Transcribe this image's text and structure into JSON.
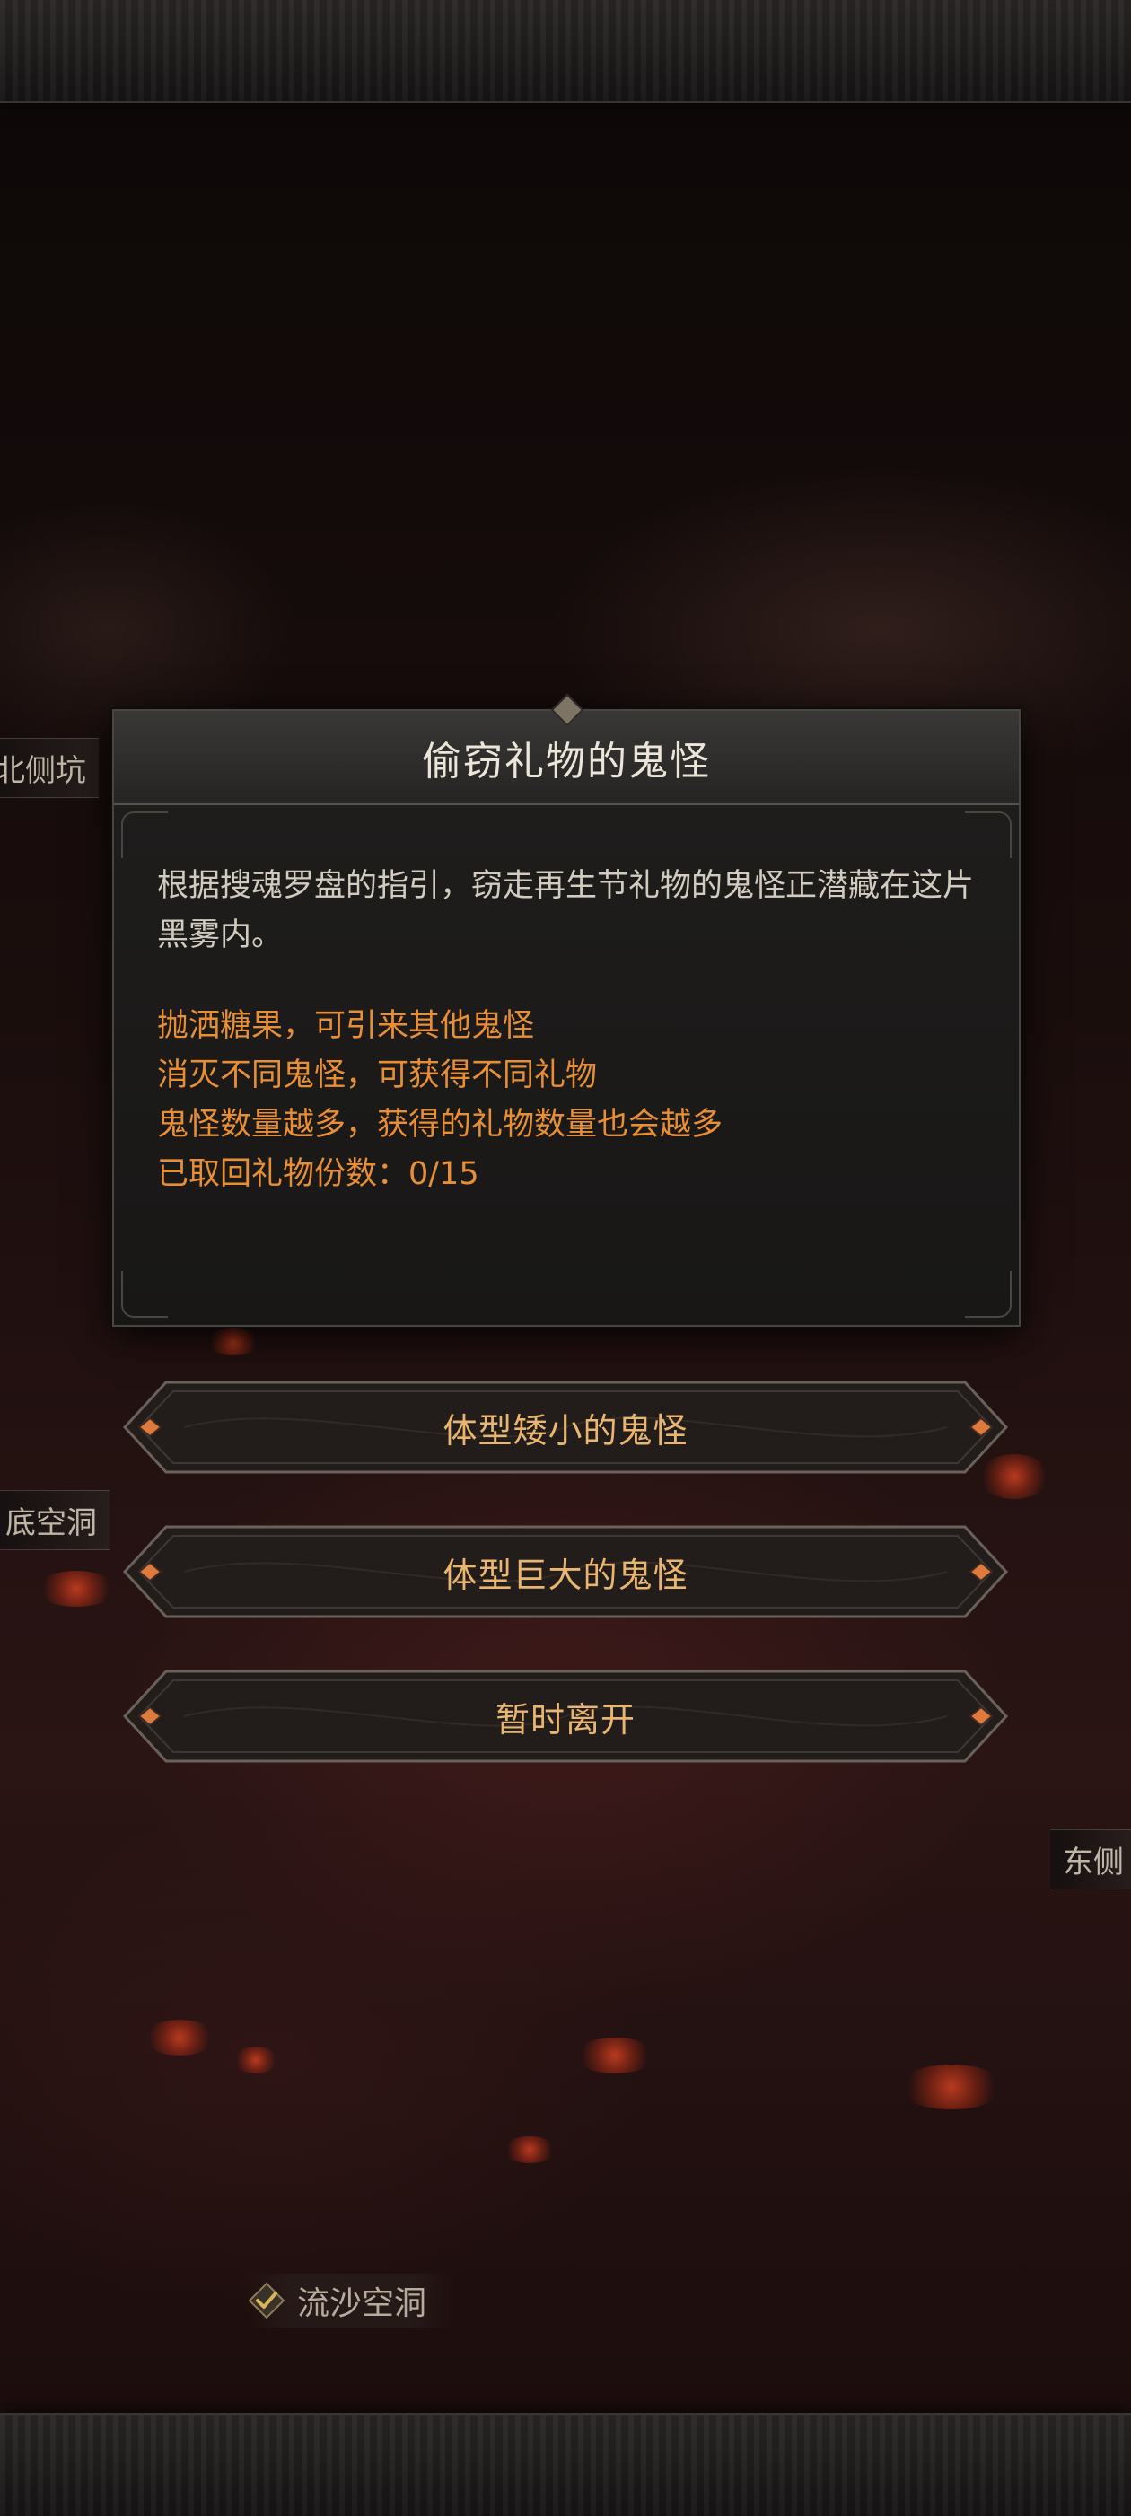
{
  "map_labels": {
    "north": "北侧坑",
    "bottom_cave": "底空洞",
    "east": "东侧",
    "quicksand": "流沙空洞"
  },
  "dialog": {
    "title": "偷窃礼物的鬼怪",
    "description": "根据搜魂罗盘的指引，窃走再生节礼物的鬼怪正潜藏在这片黑雾内。",
    "hints": [
      "抛洒糖果，可引来其他鬼怪",
      "消灭不同鬼怪，可获得不同礼物",
      "鬼怪数量越多，获得的礼物数量也会越多",
      "已取回礼物份数：0/15"
    ]
  },
  "options": {
    "small": "体型矮小的鬼怪",
    "large": "体型巨大的鬼怪",
    "leave": "暂时离开"
  },
  "colors": {
    "hint": "#e88f36",
    "option_text": "#e8b671",
    "title": "#ece6da"
  }
}
